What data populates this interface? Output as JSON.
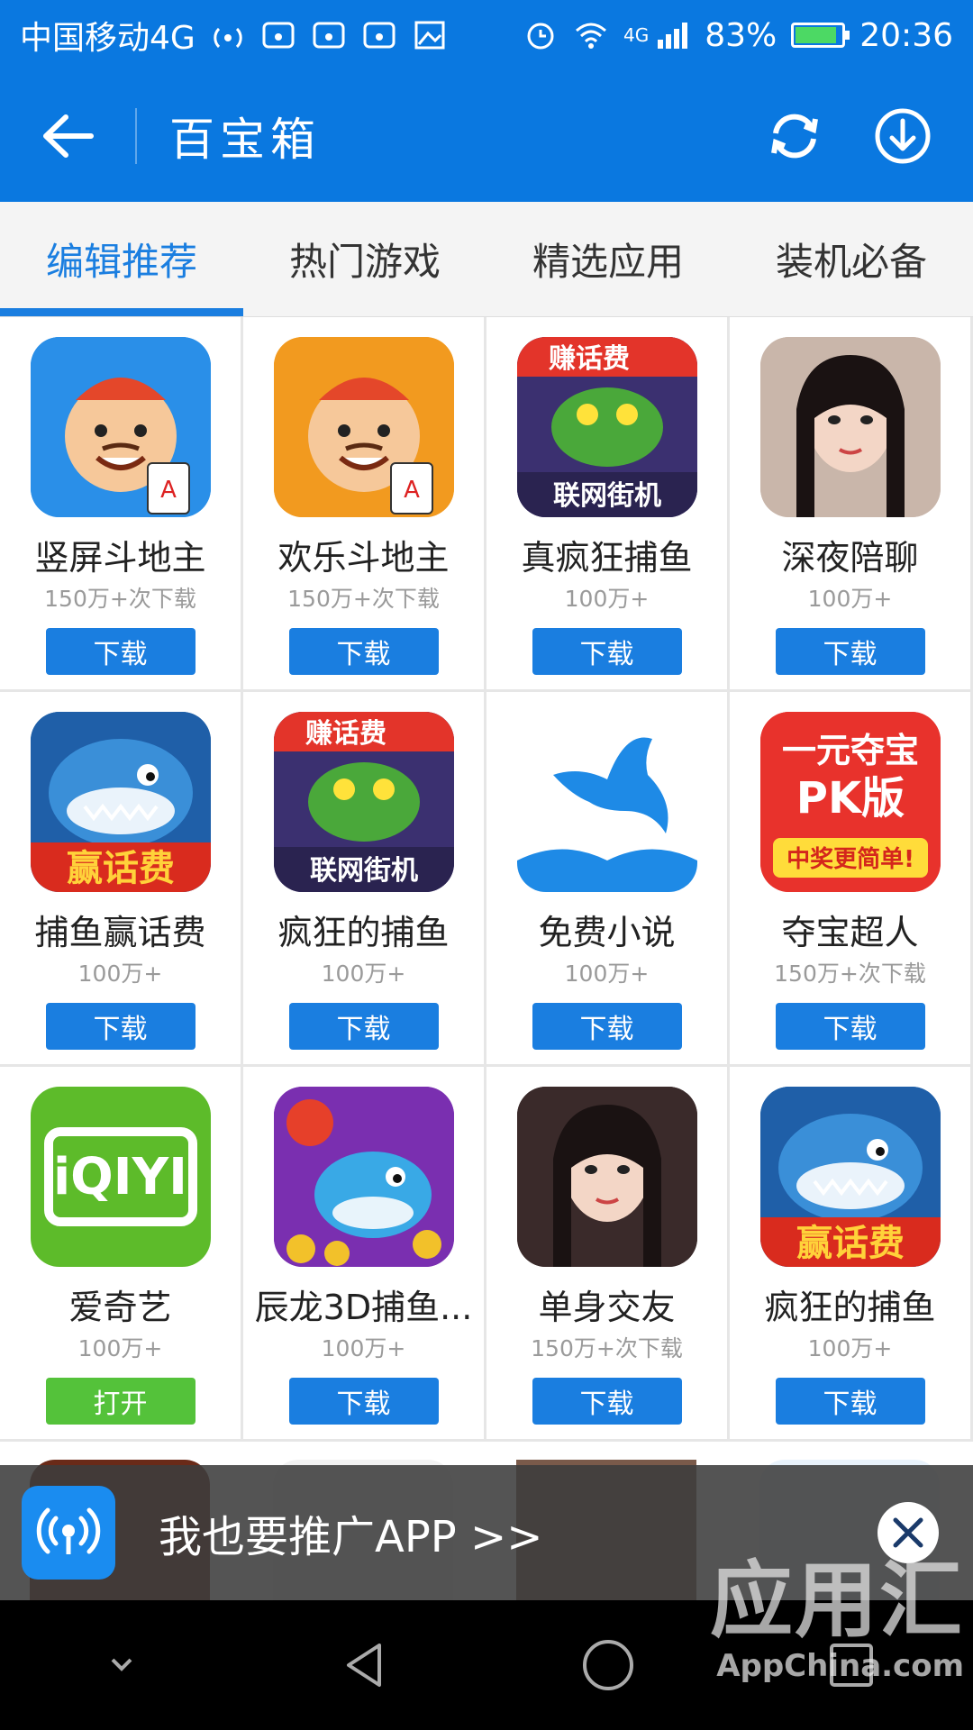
{
  "status_bar": {
    "carrier": "中国移动4G",
    "battery": "83%",
    "time": "20:36",
    "network_badge": "4G"
  },
  "appbar": {
    "title": "百宝箱"
  },
  "tabs": [
    {
      "label": "编辑推荐",
      "active": true
    },
    {
      "label": "热门游戏",
      "active": false
    },
    {
      "label": "精选应用",
      "active": false
    },
    {
      "label": "装机必备",
      "active": false
    }
  ],
  "apps": [
    {
      "name": "竖屏斗地主",
      "meta": "150万+次下载",
      "button": "下载",
      "icon": "poker-king-icon",
      "color": "#2a8fe8"
    },
    {
      "name": "欢乐斗地主",
      "meta": "150万+次下载",
      "button": "下载",
      "icon": "poker-farmer-icon",
      "color": "#f29a1f"
    },
    {
      "name": "真疯狂捕鱼",
      "meta": "100万+",
      "button": "下载",
      "icon": "fish-arcade-icon",
      "color": "#4a3a8a",
      "badge": "赚话费",
      "sub": "联网街机"
    },
    {
      "name": "深夜陪聊",
      "meta": "100万+",
      "button": "下载",
      "icon": "portrait-photo-icon",
      "color": "#c9b6aa"
    },
    {
      "name": "捕鱼赢话费",
      "meta": "100万+",
      "button": "下载",
      "icon": "shark-icon",
      "color": "#1e6fb8",
      "sub": "赢话费"
    },
    {
      "name": "疯狂的捕鱼",
      "meta": "100万+",
      "button": "下载",
      "icon": "fish-arcade-icon",
      "color": "#4a3a8a",
      "badge": "赚话费",
      "sub": "联网街机"
    },
    {
      "name": "免费小说",
      "meta": "100万+",
      "button": "下载",
      "icon": "dolphin-icon",
      "color": "#ffffff"
    },
    {
      "name": "夺宝超人",
      "meta": "150万+次下载",
      "button": "下载",
      "icon": "treasure-icon",
      "color": "#e8322c",
      "badge": "一元夺宝",
      "sub": "PK版",
      "tag": "中奖更简单!"
    },
    {
      "name": "爱奇艺",
      "meta": "100万+",
      "button": "打开",
      "icon": "iqiyi-icon",
      "color": "#5dbb2a",
      "logo": "iQIYI"
    },
    {
      "name": "辰龙3D捕鱼...",
      "meta": "100万+",
      "button": "下载",
      "icon": "rocket-shark-icon",
      "color": "#7a2fb0"
    },
    {
      "name": "单身交友",
      "meta": "150万+次下载",
      "button": "下载",
      "icon": "portrait-photo-icon",
      "color": "#3a2a2a"
    },
    {
      "name": "疯狂的捕鱼",
      "meta": "100万+",
      "button": "下载",
      "icon": "shark-icon",
      "color": "#1e6fb8",
      "sub": "赢话费"
    }
  ],
  "promo": {
    "text": "我也要推广APP  >>"
  },
  "watermark": {
    "main": "应用汇",
    "sub": "AppChina.com"
  }
}
